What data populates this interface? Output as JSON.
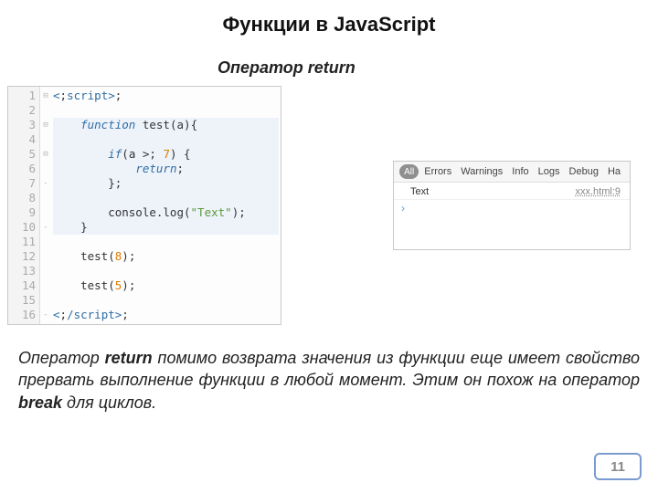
{
  "title_line1": "Функции в JavaScript",
  "subtitle": "Оператор return",
  "code": {
    "lines": [
      "<script>",
      "",
      "    function test(a){",
      "",
      "        if(a > 7) {",
      "            return;",
      "        };",
      "",
      "        console.log(\"Text\");",
      "    }",
      "",
      "    test(8);",
      "",
      "    test(5);",
      "",
      "</script>"
    ],
    "fold_markers": {
      "1": "⊟",
      "3": "⊟",
      "5": "⊟",
      "7": "-",
      "10": "-",
      "16": "-"
    }
  },
  "console": {
    "tabs": [
      "All",
      "Errors",
      "Warnings",
      "Info",
      "Logs",
      "Debug",
      "Ha"
    ],
    "rows": [
      {
        "msg": "Text",
        "src": "xxx.html:9"
      }
    ],
    "prompt": "›"
  },
  "explanation": {
    "pre": "Оператор ",
    "kw1": "return",
    "mid": " помимо возврата значения из функции еще имеет свойство прервать выполнение функции в любой момент. Этим он похож на оператор ",
    "kw2": "break",
    "post": " для циклов."
  },
  "page_number": "11"
}
